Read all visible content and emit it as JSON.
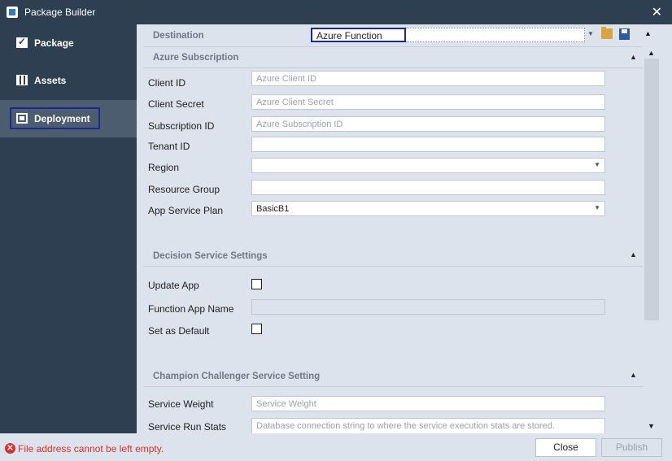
{
  "window": {
    "title": "Package Builder",
    "close": "✕"
  },
  "sidebar": {
    "items": [
      {
        "label": "Package"
      },
      {
        "label": "Assets"
      },
      {
        "label": "Deployment"
      }
    ]
  },
  "destination": {
    "label": "Destination",
    "value": "Azure Function"
  },
  "azure_section": {
    "title": "Azure Subscription",
    "fields": [
      {
        "label": "Client ID",
        "placeholder": "Azure Client ID",
        "value": ""
      },
      {
        "label": "Client Secret",
        "placeholder": "Azure Client Secret",
        "value": ""
      },
      {
        "label": "Subscription ID",
        "placeholder": "Azure Subscription ID",
        "value": ""
      },
      {
        "label": "Tenant ID",
        "placeholder": "",
        "value": ""
      },
      {
        "label": "Region",
        "placeholder": "",
        "value": ""
      },
      {
        "label": "Resource Group",
        "placeholder": "",
        "value": ""
      },
      {
        "label": "App Service Plan",
        "placeholder": "",
        "value": "BasicB1"
      }
    ]
  },
  "decision_section": {
    "title": "Decision Service Settings",
    "update_app_label": "Update App",
    "function_app_name_label": "Function App Name",
    "set_default_label": "Set as Default"
  },
  "champion_section": {
    "title": "Champion Challenger Service Setting",
    "service_weight_label": "Service Weight",
    "service_weight_placeholder": "Service Weight",
    "run_stats_label": "Service Run Stats",
    "run_stats_placeholder": "Database connection string to where the service execution stats are stored."
  },
  "footer": {
    "error": "File address cannot be left empty.",
    "close_label": "Close",
    "publish_label": "Publish"
  },
  "colors": {
    "sidebar": "#2e3f52",
    "active": "#4c5d70",
    "error": "#d9302a",
    "focus": "#1d2a8c"
  }
}
